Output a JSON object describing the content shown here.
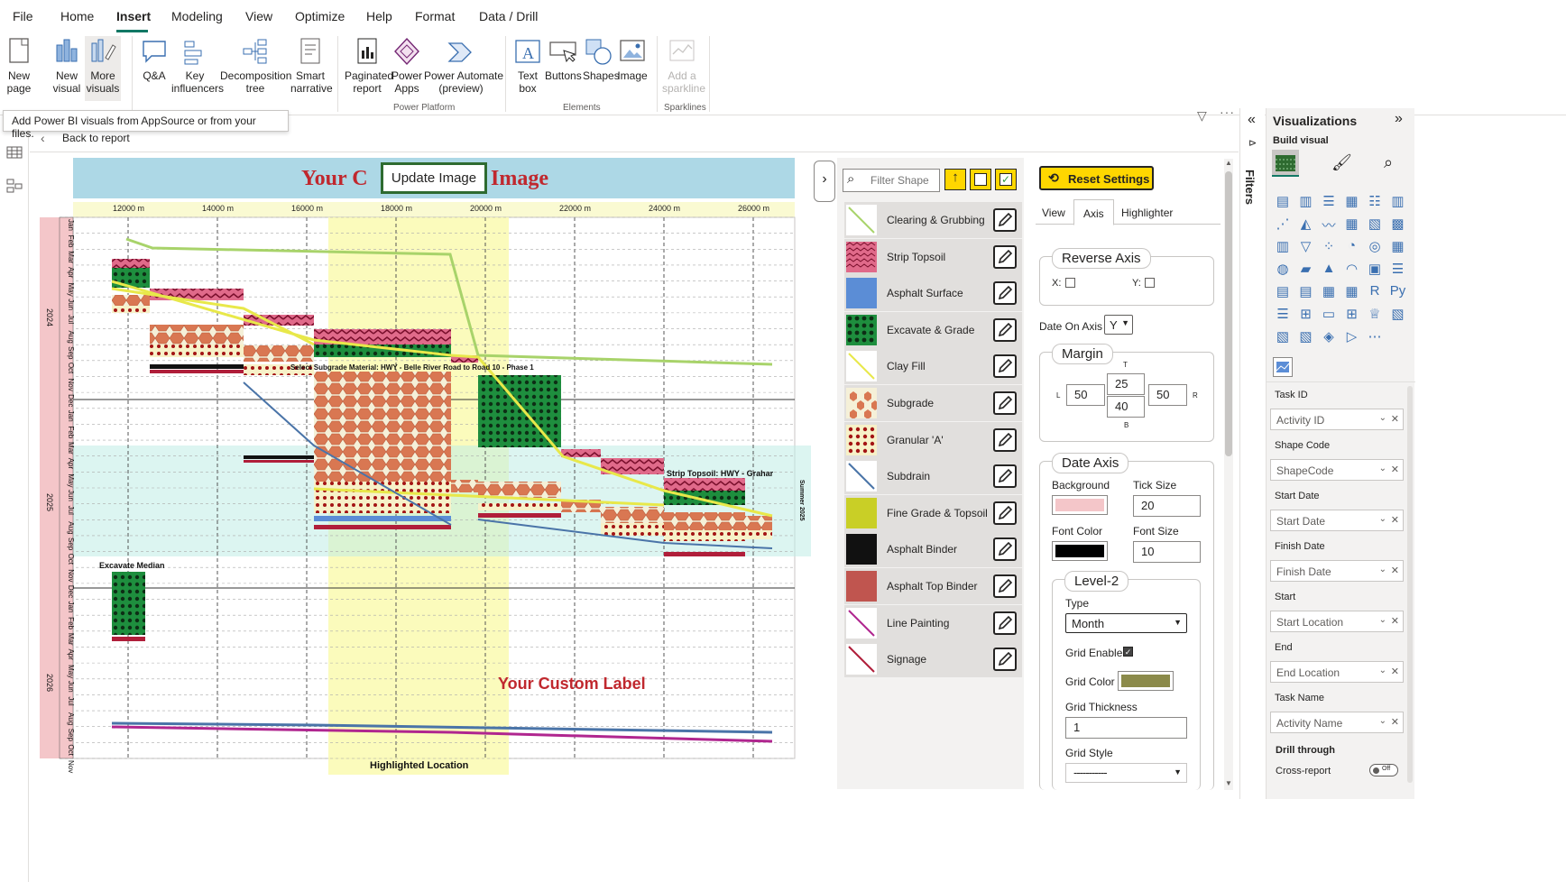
{
  "menu": {
    "items": [
      "File",
      "Home",
      "Insert",
      "Modeling",
      "View",
      "Optimize",
      "Help",
      "Format",
      "Data / Drill"
    ],
    "active": "Insert"
  },
  "ribbon": {
    "buttons": [
      {
        "label": "New\npage",
        "dropdown": true,
        "icon": "new-page-icon"
      },
      {
        "label": "New\nvisual",
        "icon": "new-visual-icon"
      },
      {
        "label": "More\nvisuals",
        "dropdown": true,
        "icon": "more-visuals-icon"
      },
      {
        "label": "Q&A",
        "icon": "qa-icon"
      },
      {
        "label": "Key\ninfluencers",
        "icon": "key-influencers-icon"
      },
      {
        "label": "Decomposition\ntree",
        "icon": "decomposition-tree-icon"
      },
      {
        "label": "Smart\nnarrative",
        "icon": "smart-narrative-icon"
      },
      {
        "label": "Paginated\nreport",
        "icon": "paginated-report-icon"
      },
      {
        "label": "Power\nApps",
        "icon": "power-apps-icon"
      },
      {
        "label": "Power Automate\n(preview)",
        "icon": "power-automate-icon"
      },
      {
        "label": "Text\nbox",
        "icon": "text-box-icon"
      },
      {
        "label": "Buttons",
        "dropdown": true,
        "icon": "buttons-icon"
      },
      {
        "label": "Shapes",
        "dropdown": true,
        "icon": "shapes-icon"
      },
      {
        "label": "Image",
        "icon": "image-icon"
      },
      {
        "label": "Add a\nsparkline",
        "disabled": true,
        "icon": "sparkline-icon"
      }
    ],
    "groups": [
      "Power Platform",
      "Elements",
      "Sparklines"
    ],
    "tooltip": "Add Power BI visuals from AppSource or from your files."
  },
  "report": {
    "back_label": "Back to report",
    "update_image_label": "Update Image",
    "banner_text_left": "Your C",
    "banner_text_right": "Image",
    "x_ticks": [
      "12000 m",
      "14000 m",
      "16000 m",
      "18000 m",
      "20000 m",
      "22000 m",
      "24000 m",
      "26000 m"
    ],
    "years": [
      "2024",
      "2025",
      "2026"
    ],
    "months": [
      "Jan",
      "Feb",
      "Mar",
      "Apr",
      "May",
      "Jun",
      "Jul",
      "Aug",
      "Sep",
      "Oct",
      "Nov",
      "Dec"
    ],
    "labels": {
      "subgrade": "Select Subgrade Material: HWY - Belle River Road to Road 10 - Phase 1",
      "strip": "Strip Topsoil: HWY - Grahar",
      "median": "Excavate Median",
      "custom": "Your Custom Label",
      "highlighted": "Highlighted Location",
      "summer": "Summer 2025"
    }
  },
  "shape_panel": {
    "filter_placeholder": "Filter Shape",
    "items": [
      {
        "label": "Clearing & Grubbing",
        "color": "#a8d36a"
      },
      {
        "label": "Strip Topsoil",
        "color": "#c23b5c"
      },
      {
        "label": "Asphalt Surface",
        "color": "#5b8dd6"
      },
      {
        "label": "Excavate & Grade",
        "color": "#2e9b44"
      },
      {
        "label": "Clay Fill",
        "color": "#e8e84a"
      },
      {
        "label": "Subgrade",
        "color": "#d97752"
      },
      {
        "label": "Granular 'A'",
        "color": "#a31414"
      },
      {
        "label": "Subdrain",
        "color": "#4a74a8"
      },
      {
        "label": "Fine Grade & Topsoil",
        "color": "#c9cf26"
      },
      {
        "label": "Asphalt Binder",
        "color": "#111111"
      },
      {
        "label": "Asphalt Top Binder",
        "color": "#c0554f"
      },
      {
        "label": "Line Painting",
        "color": "#b0268f"
      },
      {
        "label": "Signage",
        "color": "#b01e3a"
      }
    ]
  },
  "settings": {
    "reset_label": "Reset Settings",
    "tabs": [
      "View",
      "Axis",
      "Highlighter"
    ],
    "active_tab": "Axis",
    "reverse_axis": {
      "title": "Reverse Axis",
      "x_label": "X:",
      "y_label": "Y:"
    },
    "date_on_axis": {
      "label": "Date On Axis",
      "value": "Y"
    },
    "margin": {
      "title": "Margin",
      "t_label": "T",
      "l_label": "L",
      "r_label": "R",
      "b_label": "B",
      "top": "25",
      "left": "50",
      "right": "50",
      "bottom": "40"
    },
    "date_axis": {
      "title": "Date Axis",
      "background_label": "Background",
      "tick_size_label": "Tick Size",
      "tick_size": "20",
      "font_color_label": "Font Color",
      "font_size_label": "Font Size",
      "font_size": "10",
      "background_color": "#f4c6c9",
      "font_color": "#000000"
    },
    "level2": {
      "title": "Level-2",
      "type_label": "Type",
      "type_value": "Month",
      "grid_enable_label": "Grid Enable",
      "grid_color_label": "Grid Color",
      "grid_color": "#8b8a4a",
      "grid_thickness_label": "Grid Thickness",
      "grid_thickness": "1",
      "grid_style_label": "Grid Style",
      "grid_style": "-----------"
    }
  },
  "filters": {
    "label": "Filters"
  },
  "visualizations": {
    "title": "Visualizations",
    "build_visual": "Build visual",
    "wells": [
      {
        "label": "Task ID",
        "value": "Activity ID"
      },
      {
        "label": "Shape Code",
        "value": "ShapeCode"
      },
      {
        "label": "Start Date",
        "value": "Start Date"
      },
      {
        "label": "Finish Date",
        "value": "Finish Date"
      },
      {
        "label": "Start",
        "value": "Start Location"
      },
      {
        "label": "End",
        "value": "End Location"
      },
      {
        "label": "Task Name",
        "value": "Activity Name"
      }
    ],
    "drill_through": "Drill through",
    "cross_report": "Cross-report",
    "toggle": "Off"
  }
}
